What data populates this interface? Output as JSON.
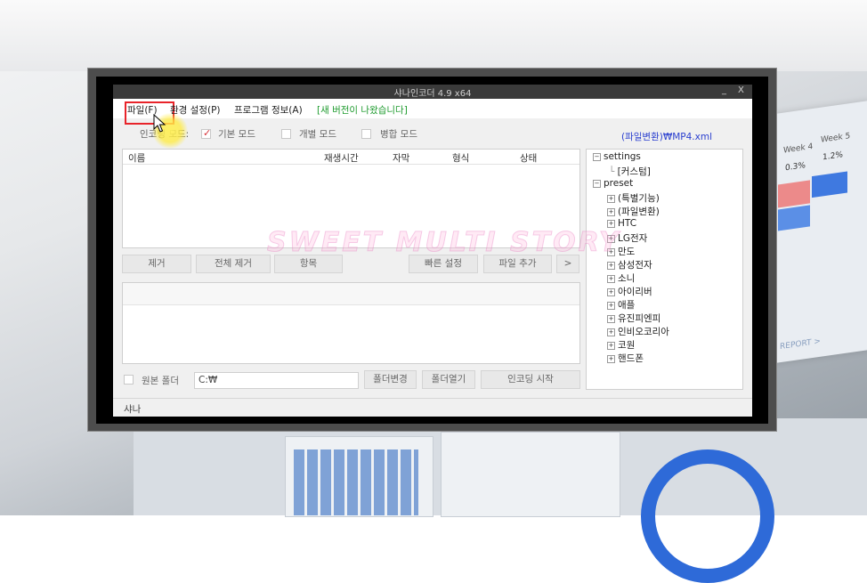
{
  "window": {
    "title": "샤나인코더 4.9 x64",
    "minimize_label": "_",
    "close_label": "X"
  },
  "menu": {
    "file": "파일(F)",
    "settings": "환경 설정(P)",
    "program_info": "프로그램 정보(A)",
    "update_notice": "[새 버전이 나왔습니다]"
  },
  "mode": {
    "label": "인코딩 모드:",
    "basic": "기본 모드",
    "individual": "개별 모드",
    "merge": "병합 모드",
    "selected": "basic"
  },
  "preset_path": "(파일변환)₩MP4.xml",
  "file_table": {
    "columns": [
      "이름",
      "재생시간",
      "자막",
      "형식",
      "상태"
    ],
    "rows": []
  },
  "buttons": {
    "remove": "제거",
    "remove_all": "전체 제거",
    "items": "항목",
    "quick_settings": "빠른 설정",
    "add_file": "파일 추가",
    "more": ">",
    "change_folder": "폴더변경",
    "open_folder": "폴더열기",
    "start_encoding": "인코딩 시작"
  },
  "output": {
    "source_folder_label": "원본 폴더",
    "folder_path": "C:₩"
  },
  "tree": {
    "settings_root": "settings",
    "settings_children": [
      "[커스텀]"
    ],
    "preset_root": "preset",
    "preset_children": [
      "(특별기능)",
      "(파일변환)",
      "HTC",
      "LG전자",
      "만도",
      "삼성전자",
      "소니",
      "아이리버",
      "애플",
      "유진피엔피",
      "인비오코리아",
      "코원",
      "핸드폰"
    ]
  },
  "status_text": "샤나",
  "watermark": "SWEET MULTI STORY",
  "background_chart": {
    "labels": [
      "Week 4",
      "Week 5",
      "0.3%",
      "1.2%",
      "REPORT >"
    ]
  },
  "colors": {
    "highlight_box": "#e8242a",
    "check_mark": "#d8333a",
    "update_text": "#1e9b2e",
    "preset_path": "#2a3fcf",
    "cursor_glow": "#ffeb3c"
  }
}
